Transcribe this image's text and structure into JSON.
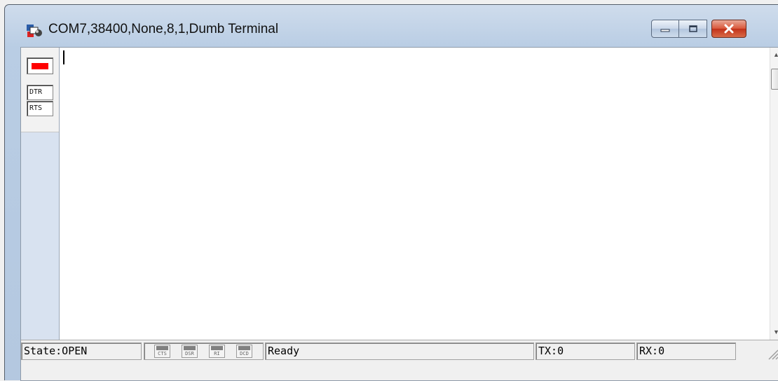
{
  "window": {
    "title": "COM7,38400,None,8,1,Dumb Terminal",
    "icon": "terminal-app-icon",
    "controls": {
      "minimize": "minimize-icon",
      "maximize": "maximize-icon",
      "close": "close-icon"
    }
  },
  "leftpanel": {
    "connect_led": "red",
    "signals": [
      "DTR",
      "RTS"
    ]
  },
  "terminal": {
    "content": ""
  },
  "statusbar": {
    "state": "State:OPEN",
    "lights": [
      "CTS",
      "DSR",
      "RI",
      "DCD"
    ],
    "message": "Ready",
    "tx": "TX:0",
    "rx": "RX:0"
  },
  "colors": {
    "led_active": "#ff0000",
    "lamp_inactive": "#808080",
    "title_gradient": "#cfdcec",
    "close_button": "#c2321a"
  }
}
